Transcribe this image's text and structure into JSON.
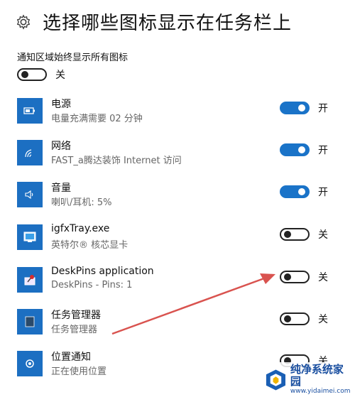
{
  "header": {
    "title": "选择哪些图标显示在任务栏上",
    "icon": "gear-icon"
  },
  "global": {
    "label": "通知区域始终显示所有图标",
    "state_text": "关",
    "on": false
  },
  "items": [
    {
      "name": "电源",
      "sub": "电量充满需要 02 分钟",
      "state_text": "开",
      "on": true,
      "icon": "battery-icon"
    },
    {
      "name": "网络",
      "sub": "FAST_a腾达装饰 Internet 访问",
      "state_text": "开",
      "on": true,
      "icon": "wifi-icon"
    },
    {
      "name": "音量",
      "sub": "喇叭/耳机: 5%",
      "state_text": "开",
      "on": true,
      "icon": "speaker-icon"
    },
    {
      "name": "igfxTray.exe",
      "sub": "英特尔® 核芯显卡",
      "state_text": "关",
      "on": false,
      "icon": "intel-graphics-icon"
    },
    {
      "name": "DeskPins application",
      "sub": "DeskPins - Pins: 1",
      "state_text": "关",
      "on": false,
      "icon": "pin-icon"
    },
    {
      "name": "任务管理器",
      "sub": "任务管理器",
      "state_text": "关",
      "on": false,
      "icon": "task-manager-icon"
    },
    {
      "name": "位置通知",
      "sub": "正在使用位置",
      "state_text": "关",
      "on": false,
      "icon": "location-icon"
    }
  ],
  "watermark": {
    "name": "纯净系统家园",
    "url": "www.yidaimei.com"
  },
  "colors": {
    "accent": "#1a73c8",
    "tile": "#1c6fc2",
    "arrow": "#d9534f"
  }
}
